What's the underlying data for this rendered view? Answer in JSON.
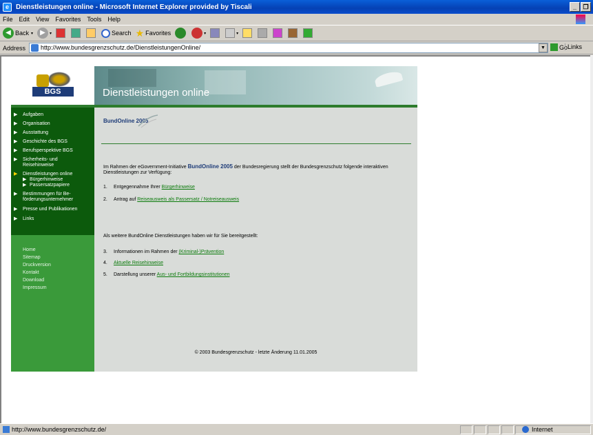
{
  "window": {
    "title": "Dienstleistungen online - Microsoft Internet Explorer provided by Tiscali",
    "minimize": "_",
    "maximize": "❐"
  },
  "menu": [
    "File",
    "Edit",
    "View",
    "Favorites",
    "Tools",
    "Help"
  ],
  "toolbar": {
    "back": "Back",
    "search": "Search",
    "favorites": "Favorites"
  },
  "address": {
    "label": "Address",
    "url": "http://www.bundesgrenzschutz.de/DienstleistungenOnline/",
    "go": "Go",
    "links": "Links"
  },
  "site": {
    "logo_text": "BGS",
    "banner_title": "Dienstleistungen online",
    "nav": [
      {
        "label": "Aufgaben"
      },
      {
        "label": "Organisation"
      },
      {
        "label": "Ausstattung"
      },
      {
        "label": "Geschichte des BGS"
      },
      {
        "label": "Berufsperspektive BGS"
      },
      {
        "label": "Sicherheits- und Reisehinweise"
      },
      {
        "label": "Dienstleistungen online"
      },
      {
        "label": "Bestimmungen für Be-förderungsunternehmer"
      },
      {
        "label": "Presse und Publikationen"
      },
      {
        "label": "Links"
      }
    ],
    "subnav": [
      "Bürgerhinweise",
      "Passersatzpapiere"
    ],
    "util": [
      "Home",
      "Sitemap",
      "Druckversion",
      "Kontakt",
      "Download",
      "Impressum"
    ],
    "bundonline_logo": "BundOnline 2005",
    "intro_pre": "Im Rahmen der eGovernment-Initiative ",
    "intro_brand": "BundOnline 2005",
    "intro_post": " der Bundesregierung stellt der Bundesgrenzschutz folgende interaktiven Dienstleistungen zur Verfügung:",
    "items1": [
      {
        "num": "1.",
        "pre": "Entgegennahme Ihrer ",
        "link": "Bürgerhinweise"
      },
      {
        "num": "2.",
        "pre": "Antrag auf ",
        "link": "Reiseausweis als Passersatz / Notreiseausweis"
      }
    ],
    "further": "Als weitere BundOnline Dienstleistungen haben wir für Sie bereitgestellt:",
    "items2": [
      {
        "num": "3.",
        "pre": "Informationen im Rahmen der ",
        "link": "(Kriminal-)Prävention"
      },
      {
        "num": "4.",
        "pre": "",
        "link": "Aktuelle Reisehinweise"
      },
      {
        "num": "5.",
        "pre": "Darstellung unserer ",
        "link": "Aus- und Fortbildungsinstitutionen"
      }
    ],
    "footer": "© 2003 Bundesgrenzschutz - letzte Änderung 11.01.2005"
  },
  "status": {
    "url": "http://www.bundesgrenzschutz.de/",
    "zone": "Internet"
  }
}
